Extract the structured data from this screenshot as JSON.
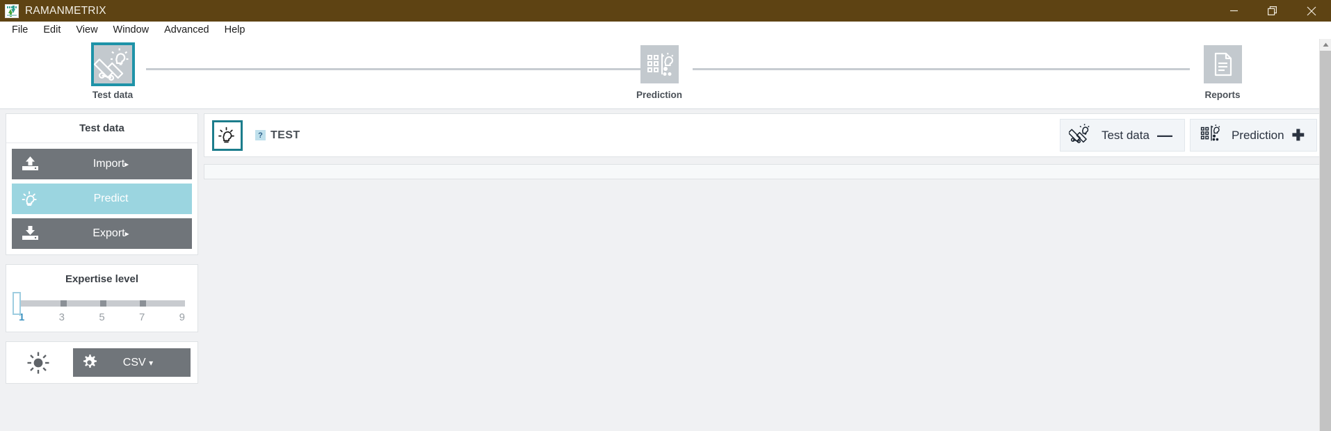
{
  "titlebar": {
    "app_name": "RAMANMETRIX",
    "icon": "ramanmetrix-logo-icon",
    "bg_color": "#5e4313",
    "controls": [
      {
        "name": "minimize",
        "glyph": "minimize-icon"
      },
      {
        "name": "restore",
        "glyph": "restore-icon"
      },
      {
        "name": "close",
        "glyph": "close-icon"
      }
    ]
  },
  "menubar": {
    "items": [
      {
        "label": "File"
      },
      {
        "label": "Edit"
      },
      {
        "label": "View"
      },
      {
        "label": "Window"
      },
      {
        "label": "Advanced"
      },
      {
        "label": "Help"
      }
    ]
  },
  "stepper": {
    "active_index": 0,
    "accent_color": "#1f93a8",
    "steps": [
      {
        "label": "Test data",
        "icon": "ruler-lightbulb-icon",
        "active": true
      },
      {
        "label": "Prediction",
        "icon": "grid-lightbulb-icon",
        "active": false
      },
      {
        "label": "Reports",
        "icon": "document-icon",
        "active": false
      }
    ]
  },
  "sidebar": {
    "panel_title": "Test data",
    "actions": [
      {
        "label": "Import",
        "caret": "▸",
        "icon": "upload-icon",
        "state": "normal"
      },
      {
        "label": "Predict",
        "caret": "",
        "icon": "lightbulb-icon",
        "state": "selected"
      },
      {
        "label": "Export",
        "caret": "▸",
        "icon": "download-icon",
        "state": "normal"
      }
    ],
    "expertise": {
      "title": "Expertise level",
      "value": 1,
      "min": 1,
      "max": 9,
      "scale": [
        "1",
        "3",
        "5",
        "7",
        "9"
      ]
    },
    "toolbar": {
      "brightness_icon": "sun-icon",
      "settings_icon": "gear-icon",
      "format_label": "CSV",
      "format_caret": "▾"
    }
  },
  "main": {
    "header": {
      "icon": "lightbulb-icon",
      "help_badge": "?",
      "title": "TEST",
      "buttons": [
        {
          "label": "Test data",
          "sign": "—",
          "icon": "ruler-lightbulb-icon",
          "action": "remove"
        },
        {
          "label": "Prediction",
          "sign": "✚",
          "icon": "grid-lightbulb-icon",
          "action": "add"
        }
      ]
    },
    "content_strip": ""
  },
  "scrollbar": {
    "up_arrow": "chevron-up-icon"
  }
}
